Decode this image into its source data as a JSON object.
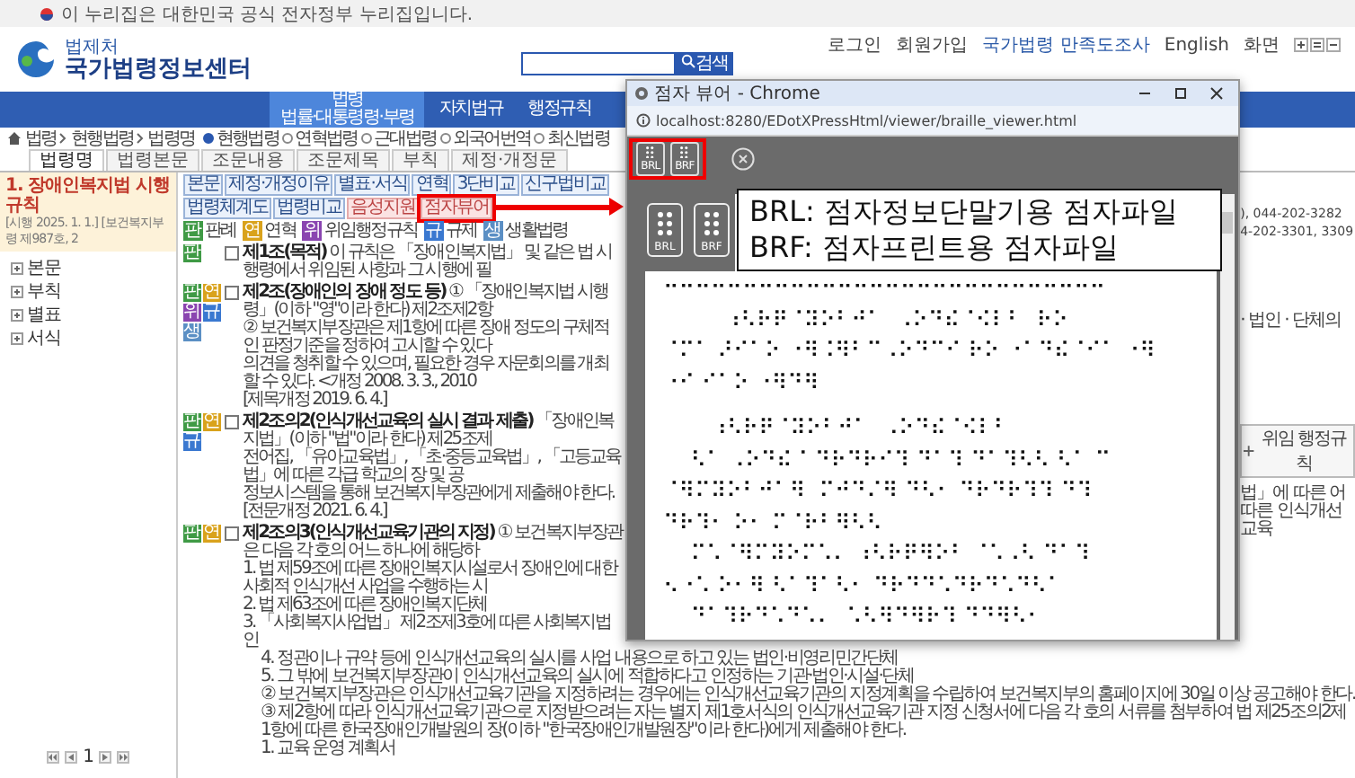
{
  "gov_notice": "이 누리집은 대한민국 공식 전자정부 누리집입니다.",
  "header": {
    "logo_small": "법제처",
    "logo_title": "국가법령정보센터",
    "search_button": "검색",
    "links": [
      "로그인",
      "회원가입",
      "국가법령 만족도조사",
      "English",
      "화면"
    ]
  },
  "nav": [
    {
      "label": "법령",
      "sub": "법률·대통령령·부령",
      "selected": true
    },
    {
      "label": "자치법규",
      "selected": false
    },
    {
      "label": "행정규칙",
      "selected": false
    }
  ],
  "breadcrumb": [
    "법령",
    "현행법령",
    "법령명"
  ],
  "scope_options": [
    {
      "label": "현행법령",
      "selected": true
    },
    {
      "label": "연혁법령",
      "selected": false
    },
    {
      "label": "근대법령",
      "selected": false
    },
    {
      "label": "외국어번역",
      "selected": false
    },
    {
      "label": "최신법령",
      "selected": false
    }
  ],
  "tabs": [
    {
      "label": "법령명",
      "selected": true
    },
    {
      "label": "법령본문",
      "selected": false
    },
    {
      "label": "조문내용",
      "selected": false
    },
    {
      "label": "조문제목",
      "selected": false
    },
    {
      "label": "부칙",
      "selected": false
    },
    {
      "label": "제정·개정문",
      "selected": false
    }
  ],
  "sidebar": {
    "title": "1. 장애인복지법 시행규칙",
    "subtitle": "[시행 2025. 1. 1.] [보건복지부령 제987호, 2",
    "items": [
      "본문",
      "부칙",
      "별표",
      "서식"
    ],
    "page": "1"
  },
  "toolbar": [
    {
      "label": "본문",
      "kind": "plain",
      "highlighted": false
    },
    {
      "label": "제정·개정이유",
      "kind": "plain",
      "highlighted": false
    },
    {
      "label": "별표·서식",
      "kind": "plain",
      "highlighted": false
    },
    {
      "label": "연혁",
      "kind": "plain",
      "highlighted": false
    },
    {
      "label": "3단비교",
      "kind": "plain",
      "highlighted": false
    },
    {
      "label": "신구법비교",
      "kind": "plain",
      "highlighted": false
    },
    {
      "label": "법령체계도",
      "kind": "plain",
      "highlighted": false
    },
    {
      "label": "법령비교",
      "kind": "plain",
      "highlighted": false
    },
    {
      "label": "음성지원",
      "kind": "pink",
      "highlighted": false
    },
    {
      "label": "점자뷰어",
      "kind": "pink",
      "highlighted": true
    }
  ],
  "legend": [
    {
      "mark": "판",
      "label": "판례",
      "color": "#3f9a45"
    },
    {
      "mark": "연",
      "label": "연혁",
      "color": "#d9a21c"
    },
    {
      "mark": "위",
      "label": "위임행정규칙",
      "color": "#8a45b0"
    },
    {
      "mark": "규",
      "label": "규제",
      "color": "#3a78d0"
    },
    {
      "mark": "생",
      "label": "생활법령",
      "color": "#5b8fc4"
    }
  ],
  "articles": [
    {
      "marks": [
        {
          "mark": "판",
          "color": "#3f9a45"
        }
      ],
      "checked": false,
      "text": "**제1조(목적)** 이 규칙은 「장애인복지법」 및 같은 법 시행령에서 위임된 사항과 그 시행에 필"
    },
    {
      "marks": [
        {
          "mark": "판",
          "color": "#3f9a45"
        },
        {
          "mark": "연",
          "color": "#d9a21c"
        },
        {
          "mark": "위",
          "color": "#8a45b0"
        },
        {
          "mark": "규",
          "color": "#3a78d0"
        },
        {
          "mark": "생",
          "color": "#5b8fc4"
        }
      ],
      "checked": false,
      "text": "**제2조(장애인의 장애 정도 등)** ① 「장애인복지법 시행령」(이하 \"영\"이라 한다) 제2조제2항",
      "lines": [
        "② 보건복지부장관은 제1항에 따른 장애 정도의 구체적인 판정기준을 정하여 고시할 수 있다",
        "의견을 청취할 수 있으며, 필요한 경우 자문회의를 개최할 수 있다. <개정 2008. 3. 3., 2010",
        "[제목개정 2019. 6. 4.]"
      ]
    },
    {
      "marks": [
        {
          "mark": "판",
          "color": "#3f9a45"
        },
        {
          "mark": "연",
          "color": "#d9a21c"
        },
        {
          "mark": "규",
          "color": "#3a78d0"
        }
      ],
      "checked": false,
      "text": "**제2조의2(인식개선교육의 실시 결과 제출)** 「장애인복지법」(이하 \"법\"이라 한다) 제25조제",
      "lines": [
        "전어집, 「유아교육법」, 「초·중등교육법」, 「고등교육법」에 따른 각급 학교의 장 및 공",
        "정보시스템을 통해 보건복지부장관에게 제출해야 한다.",
        "[전문개정 2021. 6. 4.]"
      ]
    },
    {
      "marks": [
        {
          "mark": "판",
          "color": "#3f9a45"
        },
        {
          "mark": "연",
          "color": "#d9a21c"
        }
      ],
      "checked": false,
      "text": "**제2조의3(인식개선교육기관의 지정)** ① 보건복지부장관은 다음 각 호의 어느 하나에 해당하",
      "lines": [
        "1. 법 제59조에 따른 장애인복지시설로서 장애인에 대한 사회적 인식개선 사업을 수행하는 시",
        "2. 법 제63조에 따른 장애인복지단체",
        "3. 「사회복지사업법」 제2조제3호에 따른 사회복지법인"
      ]
    }
  ],
  "lower_lines": [
    "4. 정관이나 규약 등에 인식개선교육의 실시를 사업 내용으로 하고 있는 법인·비영리민간단체",
    "5. 그 밖에 보건복지부장관이 인식개선교육의 실시에 적합하다고 인정하는 기관·법인·시설·단체",
    "② 보건복지부장관은 인식개선교육기관을 지정하려는 경우에는 인식개선교육기관의 지정계획을 수립하여 보건복지부의 홈페이지에 30일 이상 공고해야 한다.",
    "③ 제2항에 따라 인식개선교육기관으로 지정받으려는 자는 별지 제1호서식의 인식개선교육기관 지정 신청서에 다음 각 호의 서류를 첨부하여 법 제25조의2제1항에 따른 한국장애인개발원의 장(이하 \"한국장애인개발원장\"이라 한다)에게 제출해야 한다.",
    "1. 교육 운영 계획서"
  ],
  "right_fragments": [
    "), 044-202-3282",
    "4-202-3301, 3309",
    "· 법인 · 단체의"
  ],
  "related_button": "위임 행정규칙",
  "right_fragments_2": [
    "법」에 따른 어",
    "따른 인식개선교육"
  ],
  "popup": {
    "title": "점자 뷰어 - Chrome",
    "url": "localhost:8280/EDotXPressHtml/viewer/braille_viewer.html",
    "toolbar_buttons": [
      "BRL",
      "BRF"
    ],
    "callout_buttons": [
      "BRL",
      "BRF"
    ],
    "callout_lines": [
      "BRL: 점자정보단말기용 점자파일",
      "BRF: 점자프린트용 점자파일"
    ],
    "braille": [
      [
        "⠒⠒⠒⠒⠒⠒⠒⠒⠒⠒⠒⠒⠒⠒⠒⠒⠒⠒⠒⠒⠒⠒⠒⠒⠒⠒⠒⠒",
        "         ⠰⠣⠗⠟⠈⠽⠕⠃⠚⠁  ⠠⠕⠙⠮⠈⠪⠇⠃  ⠗⠕",
        "⠈⠍⠁ ⠜⠊⠁⠕ ⠐⠻⠨⠻⠃⠉⠠⠕⠙⠉⠊ ⠗⠕ ⠐⠁⠙⠮⠈⠊⠁ ⠐⠻",
        "⠐⠊ ⠊⠁⠕ ⠐⠻⠙⠻"
      ],
      [
        "       ⠰⠣⠗⠟⠈⠽⠕⠃⠚⠁  ⠠⠕⠙⠮⠈⠪⠇⠃",
        "    ⠣⠁ ⠠⠕⠙⠮⠈ ⠙⠗⠙⠗⠊⠹ ⠙⠁⠹ ⠙⠁⠹⠣⠣ ⠣⠁ ⠉",
        "⠈⠻⠍⠽⠕⠃⠚⠁⠻  ⠍⠚⠙⠌⠻ ⠙⠣⠂ ⠙⠗⠙⠗⠹⠹ ⠙⠹",
        "⠙⠗⠹⠂ ⠕⠂ ⠍⠈⠗⠃⠻⠣⠣",
        "    ⠍⠡⠈⠻⠍⠽⠕⠍⠡⠄ ⠰⠣⠗⠟⠻⠕⠃ ⠈⠡⠠⠣ ⠙⠁⠹",
        "⠢⠐⠡ ⠕⠂⠻ ⠣⠁⠹⠁⠣⠂ ⠙⠗⠙⠙⠡⠙⠗⠙⠡⠙⠣⠁",
        "    ⠙⠁⠹⠗⠙⠡⠙⠡⠄  ⠡⠣⠻⠙⠻⠗⠹ ⠙⠙⠻⠣⠂"
      ]
    ]
  }
}
